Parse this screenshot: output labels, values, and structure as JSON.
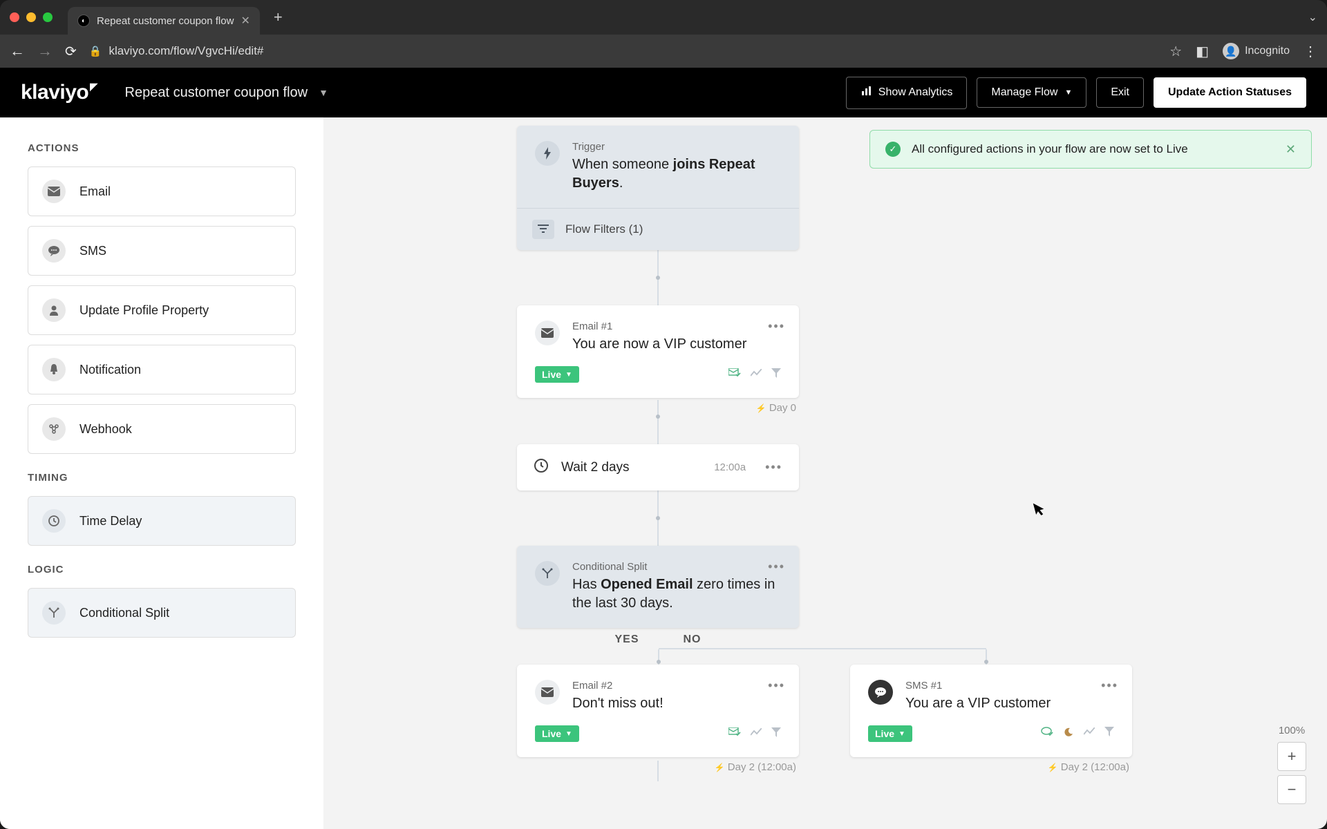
{
  "browser": {
    "tab_title": "Repeat customer coupon flow",
    "url": "klaviyo.com/flow/VgvcHi/edit#",
    "incognito_label": "Incognito"
  },
  "header": {
    "logo": "klaviyo",
    "flow_name": "Repeat customer coupon flow",
    "show_analytics": "Show Analytics",
    "manage_flow": "Manage Flow",
    "exit": "Exit",
    "update_statuses": "Update Action Statuses"
  },
  "sidebar": {
    "actions_heading": "ACTIONS",
    "timing_heading": "TIMING",
    "logic_heading": "LOGIC",
    "items": {
      "email": "Email",
      "sms": "SMS",
      "update_profile": "Update Profile Property",
      "notification": "Notification",
      "webhook": "Webhook",
      "time_delay": "Time Delay",
      "conditional_split": "Conditional Split"
    }
  },
  "toast": {
    "message": "All configured actions in your flow are now set to Live"
  },
  "flow": {
    "trigger": {
      "label": "Trigger",
      "prefix": "When someone ",
      "bold": "joins Repeat Buyers",
      "suffix": ".",
      "filters": "Flow Filters (1)"
    },
    "email1": {
      "label": "Email #1",
      "title": "You are now a VIP customer",
      "status": "Live",
      "day": "Day 0"
    },
    "wait": {
      "title": "Wait 2 days",
      "time": "12:00a"
    },
    "split": {
      "label": "Conditional Split",
      "prefix": "Has ",
      "bold": "Opened Email",
      "suffix": " zero times in the last 30 days.",
      "yes": "YES",
      "no": "NO"
    },
    "email2": {
      "label": "Email #2",
      "title": "Don't miss out!",
      "status": "Live",
      "day": "Day 2 (12:00a)"
    },
    "sms1": {
      "label": "SMS #1",
      "title": "You are a VIP customer",
      "status": "Live",
      "day": "Day 2 (12:00a)"
    }
  },
  "zoom": {
    "pct": "100%",
    "plus": "+",
    "minus": "−"
  }
}
